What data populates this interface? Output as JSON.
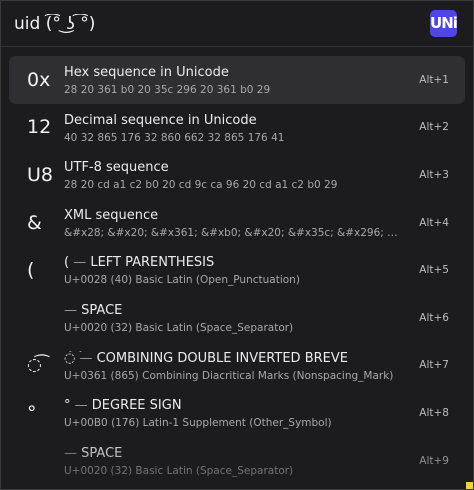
{
  "search": {
    "value": "uid (͡° ͜ʖ ͡°)",
    "logo_text": "UNi"
  },
  "results": [
    {
      "glyph": "0x",
      "title": "Hex sequence in Unicode",
      "subtitle": "28 20 361 b0 20 35c 296 20 361 b0 29",
      "shortcut": "Alt+1"
    },
    {
      "glyph": "12",
      "title": "Decimal sequence in Unicode",
      "subtitle": "40 32 865 176 32 860 662 32 865 176 41",
      "shortcut": "Alt+2"
    },
    {
      "glyph": "U8",
      "title": "UTF-8 sequence",
      "subtitle": "28 20 cd a1 c2 b0 20 cd 9c ca 96 20 cd a1 c2 b0 29",
      "shortcut": "Alt+3"
    },
    {
      "glyph": "&",
      "title": "XML sequence",
      "subtitle": "&#x28; &#x20; &#x361; &#xb0; &#x20; &#x35c; &#x296; &#x20;…",
      "shortcut": "Alt+4"
    },
    {
      "glyph": "(",
      "title_char": "(",
      "title_dash": " — ",
      "title_name": "LEFT PARENTHESIS",
      "subtitle": "U+0028 (40) Basic Latin (Open_Punctuation)",
      "shortcut": "Alt+5"
    },
    {
      "glyph": " ",
      "title_char": " ",
      "title_dash": " — ",
      "title_name": "SPACE",
      "subtitle": "U+0020 (32) Basic Latin (Space_Separator)",
      "shortcut": "Alt+6"
    },
    {
      "glyph": "◌͡",
      "title_char": "◌͡",
      "title_dash": " — ",
      "title_name": "COMBINING DOUBLE INVERTED BREVE",
      "subtitle": "U+0361 (865) Combining Diacritical Marks (Nonspacing_Mark)",
      "shortcut": "Alt+7"
    },
    {
      "glyph": "°",
      "title_char": "°",
      "title_dash": " — ",
      "title_name": "DEGREE SIGN",
      "subtitle": "U+00B0 (176) Latin-1 Supplement (Other_Symbol)",
      "shortcut": "Alt+8"
    },
    {
      "glyph": " ",
      "title_char": " ",
      "title_dash": " — ",
      "title_name": "SPACE",
      "subtitle": "U+0020 (32) Basic Latin (Space_Separator)",
      "shortcut": "Alt+9"
    }
  ],
  "colors": {
    "background": "#1c1c1e",
    "selected_row": "#2f2f33",
    "logo_accent": "#4f46e5"
  }
}
